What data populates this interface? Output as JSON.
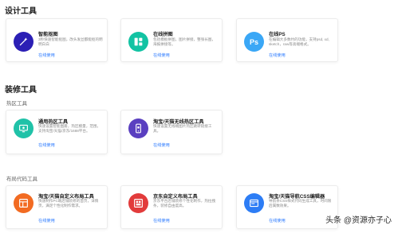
{
  "sections": {
    "design_title": "设计工具",
    "decor_title": "装修工具",
    "hotspot_subtitle": "热区工具",
    "layout_subtitle": "布局代码工具"
  },
  "cards": {
    "smart_cutout": {
      "name": "智能抠图",
      "desc": "3秒快速智能抠图，改头发丝都能抠的明明白白",
      "link": "在线使用",
      "color": "#2b1fb5",
      "icon": "magic-wand-icon"
    },
    "collage": {
      "name": "在线拼图",
      "desc": "包括模板拼图，图片拼接，整张长图，海报拼接等。",
      "link": "在线使用",
      "color": "#12c3a3",
      "icon": "collage-icon"
    },
    "online_ps": {
      "name": "在线PS",
      "desc": "在编辑大多数约的功能，支持psd, xd, sketch，raw等高端格式。",
      "link": "在线使用",
      "color": "#3aa7f6",
      "icon": "ps-icon"
    },
    "hotspot_general": {
      "name": "通用热区工具",
      "desc": "快速设置智能图册，热区模量，范围，支持淘宝/天猫/京东/1688平台。",
      "link": "在线使用",
      "color": "#20c2a8",
      "icon": "screen-icon"
    },
    "hotspot_wireless": {
      "name": "淘宝/天猫无线热区工具",
      "desc": "快速设置无线端图片热区跳转链接工具。",
      "link": "在线使用",
      "color": "#5a3fc0",
      "icon": "phone-icon"
    },
    "layout_taobao": {
      "name": "淘宝/天猫自定义布局工具",
      "desc": "快速制作PC端店铺装修的首页，详情页，满足个性化制作需求。",
      "link": "在线使用",
      "color": "#f26b22",
      "icon": "layout-icon"
    },
    "layout_jd": {
      "name": "京东自定义布局工具",
      "desc": "京东平台店铺装修个性化制作，热拉拽条，装修自由度高。",
      "link": "在线使用",
      "color": "#e23b3b",
      "icon": "grid-icon"
    },
    "nav_css": {
      "name": "淘宝/天猫导航CSS编辑器",
      "desc": "导航条CSS样式代码生成工具，时间限后属数效果。",
      "link": "在线使用",
      "color": "#2d7df5",
      "icon": "browser-icon"
    }
  },
  "watermark": "头条 @资源亦子心"
}
